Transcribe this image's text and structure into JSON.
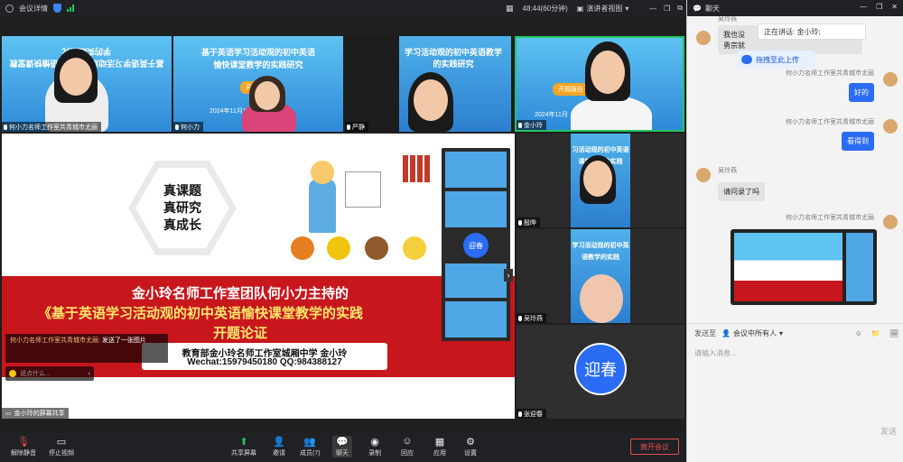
{
  "topbar": {
    "meeting_info": "会议详情",
    "timer": "48:44(60分钟)",
    "view_mode": "演讲者视图"
  },
  "tiles": {
    "t1_name": "何小力名师工作室共青城市尤丽",
    "t2_name": "何小力",
    "t3_name": "严静",
    "t4_name": "金小玲",
    "t5_name": "殷晔",
    "t6_name": "吴玲燕",
    "t7_name": "张迎春",
    "avatar_text": "迎春"
  },
  "slides": {
    "t1_text": "基于英语学习活动观的初中英语愉快课堂教学的实践研究",
    "t2_title": "基于英语学习活动观的初中英语",
    "t2_title2": "愉快课堂教学的实践研究",
    "t2_btn": "开题报告",
    "t2_date": "2024年11月17日",
    "t3_text": "学习活动观的初中英语教学的实践研究",
    "t4_btn": "开题报告",
    "t4_date": "2024年11月",
    "t5_text": "习活动观的初中英语课堂教学的实践",
    "t6_text": "学习活动观的初中英语教学的实践"
  },
  "share": {
    "hex_lines": [
      "真课题",
      "真研究",
      "真成长"
    ],
    "title1": "金小玲名师工作室团队何小力主持的",
    "title2": "《基于英语学习活动观的初中英语愉快课堂教学的实践",
    "title3": "开题论证",
    "contact1": "教育部金小玲名师工作室城厢中学  金小玲",
    "contact2": "Wechat:15979450180   QQ:984388127",
    "mini_avatar": "迎春",
    "notif_sender": "何小力名师工作室共青城市尤丽:",
    "notif_body": "发送了一张图片",
    "quick_placeholder": "说点什么...",
    "share_label": "金小玲的屏幕共享"
  },
  "toolbar": {
    "mute": "解除静音",
    "video": "停止视频",
    "share": "共享屏幕",
    "invite": "邀请",
    "members": "成员(7)",
    "chat": "聊天",
    "record": "录制",
    "review": "回应",
    "apps": "应用",
    "settings": "设置",
    "leave": "离开会议"
  },
  "chat": {
    "title": "聊天",
    "sender_top": "吴玲燕",
    "partial_msg": "我也没",
    "partial_msg2": "勇宗就",
    "speaking_label": "正在讲话:",
    "speaking_name": "金小玲;",
    "upload_label": "拖拽至此上传",
    "msg1_sender": "何小力名师工作室共青城市尤丽",
    "msg1_text": "好的",
    "msg2_sender": "何小力名师工作室共青城市尤丽",
    "msg2_text": "看得到",
    "msg3_sender": "吴玲燕",
    "msg3_text": "请问录了吗",
    "msg4_sender": "何小力名师工作室共青城市尤丽",
    "send_to_label": "发送至",
    "send_to_value": "会议中所有人",
    "input_placeholder": "请输入消息...",
    "send_button": "发送"
  }
}
